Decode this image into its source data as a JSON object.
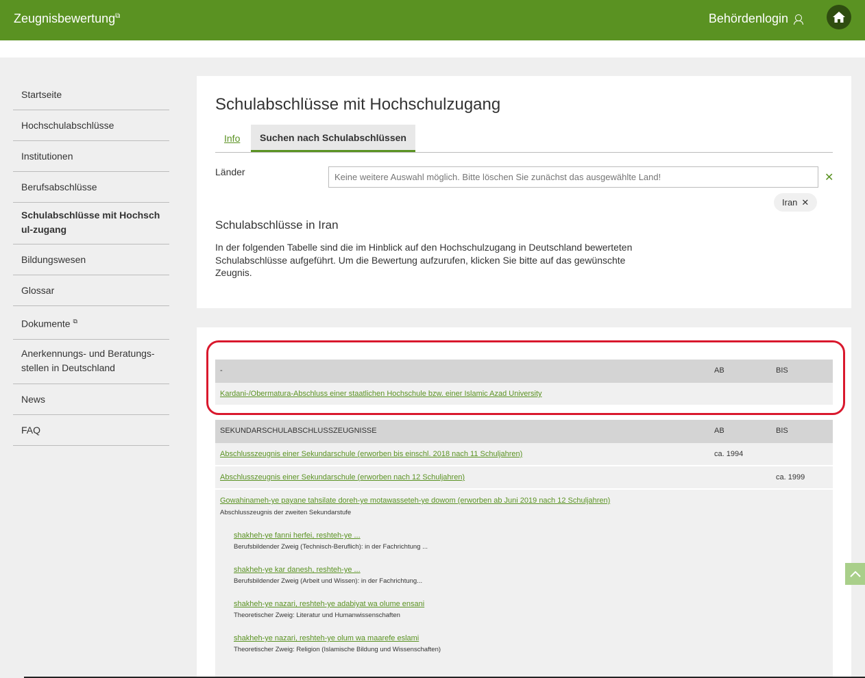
{
  "header": {
    "brand": "Zeugnisbewertung",
    "login": "Behördenlogin"
  },
  "sidebar": {
    "items": [
      {
        "label": "Startseite"
      },
      {
        "label": "Hochschulabschlüsse"
      },
      {
        "label": "Institutionen"
      },
      {
        "label": "Berufsabschlüsse"
      },
      {
        "label": "Schulabschlüsse mit Hochschul-zugang",
        "active": true
      },
      {
        "label": "Bildungswesen"
      },
      {
        "label": "Glossar"
      },
      {
        "label": "Dokumente"
      },
      {
        "label": "Anerkennungs- und Beratungs-stellen in Deutschland"
      },
      {
        "label": "News"
      },
      {
        "label": "FAQ"
      }
    ]
  },
  "main": {
    "title": "Schulabschlüsse mit Hochschulzugang",
    "tabs": {
      "info": "Info",
      "search": "Suchen nach Schulabschlüssen"
    },
    "laender_label": "Länder",
    "laender_placeholder": "Keine weitere Auswahl möglich. Bitte löschen Sie zunächst das ausgewählte Land!",
    "chip": "Iran",
    "subtitle": "Schulabschlüsse in Iran",
    "description": "In der folgenden Tabelle sind die im Hinblick auf den Hochschulzugang in Deutschland bewerteten Schulabschlüsse aufgeführt. Um die Bewertung aufzurufen, klicken Sie bitte auf das gewünschte Zeugnis."
  },
  "table1": {
    "head": {
      "title": "-",
      "ab": "AB",
      "bis": "BIS"
    },
    "rows": [
      {
        "label": "Kardani-/Obermatura-Abschluss einer staatlichen Hochschule bzw. einer Islamic Azad University",
        "ab": "",
        "bis": ""
      }
    ]
  },
  "table2": {
    "head": {
      "title": "SEKUNDARSCHULABSCHLUSSZEUGNISSE",
      "ab": "AB",
      "bis": "BIS"
    },
    "rows": [
      {
        "label": "Abschlusszeugnis einer Sekundarschule (erworben bis einschl. 2018 nach 11 Schuljahren)",
        "ab": "ca. 1994",
        "bis": ""
      },
      {
        "label": "Abschlusszeugnis einer Sekundarschule (erworben nach 12 Schuljahren)",
        "ab": "",
        "bis": "ca. 1999"
      },
      {
        "label": "Gowahinameh-ye payane tahsilate doreh-ye motawasseteh-ye dowom (erworben ab Juni 2019 nach 12 Schuljahren)",
        "sub": "Abschlusszeugnis der zweiten Sekundarstufe"
      }
    ],
    "subitems": [
      {
        "label": "shakheh-ye fanni herfei, reshteh-ye ...",
        "desc": "Berufsbildender Zweig (Technisch-Beruflich): in der Fachrichtung ..."
      },
      {
        "label": "shakheh-ye kar danesh, reshteh-ye ...",
        "desc": "Berufsbildender Zweig (Arbeit und Wissen): in der Fachrichtung..."
      },
      {
        "label": "shakheh-ye nazari, reshteh-ye adabiyat wa olume ensani",
        "desc": "Theoretischer Zweig: Literatur und Humanwissenschaften"
      },
      {
        "label": "shakheh-ye nazari, reshteh-ye olum wa maarefe eslami",
        "desc": "Theoretischer Zweig: Religion (Islamische Bildung und Wissenschaften)"
      }
    ]
  },
  "colors": {
    "brand_green": "#5a9222",
    "highlight_red": "#d9182d"
  }
}
